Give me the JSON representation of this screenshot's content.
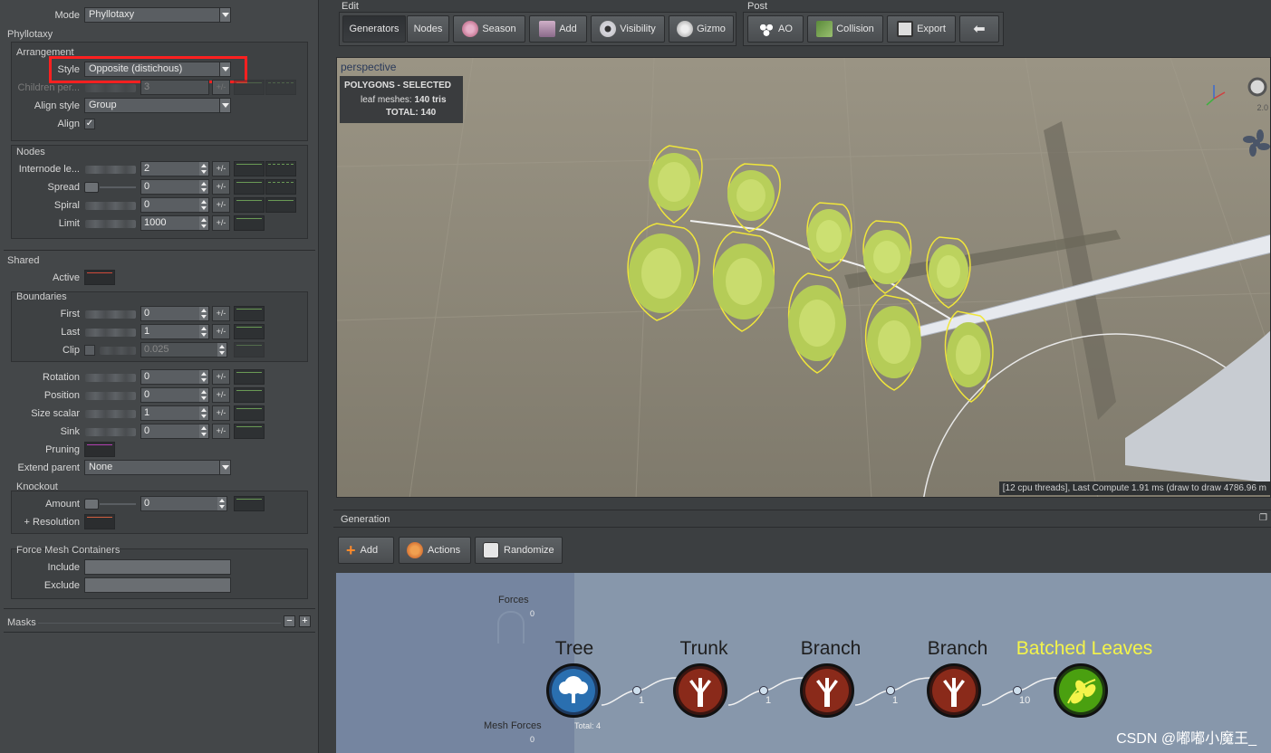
{
  "left": {
    "mode_label": "Mode",
    "mode_value": "Phyllotaxy",
    "phyllotaxy_title": "Phyllotaxy",
    "arrangement_title": "Arrangement",
    "style_label": "Style",
    "style_value": "Opposite (distichous)",
    "children_label": "Children per...",
    "children_value": "3",
    "align_style_label": "Align style",
    "align_style_value": "Group",
    "align_label": "Align",
    "align_checked": "✓",
    "nodes_title": "Nodes",
    "internode_label": "Internode le...",
    "internode_value": "2",
    "spread_label": "Spread",
    "spread_value": "0",
    "spiral_label": "Spiral",
    "spiral_value": "0",
    "limit_label": "Limit",
    "limit_value": "1000",
    "shared_title": "Shared",
    "active_label": "Active",
    "boundaries_title": "Boundaries",
    "first_label": "First",
    "first_value": "0",
    "last_label": "Last",
    "last_value": "1",
    "clip_label": "Clip",
    "clip_value": "0.025",
    "rotation_label": "Rotation",
    "rotation_value": "0",
    "position_label": "Position",
    "position_value": "0",
    "size_label": "Size scalar",
    "size_value": "1",
    "sink_label": "Sink",
    "sink_value": "0",
    "pruning_label": "Pruning",
    "extend_label": "Extend parent",
    "extend_value": "None",
    "knockout_title": "Knockout",
    "amount_label": "Amount",
    "amount_value": "0",
    "resolution_label": "+ Resolution",
    "fmc_title": "Force Mesh Containers",
    "include_label": "Include",
    "exclude_label": "Exclude",
    "masks_label": "Masks",
    "pm_label": "+/-",
    "colors": {
      "active_line": "#d04a3a",
      "pruning_line": "#b040b0",
      "resolution_line": "#d06040",
      "highlight_box": "#ff2020"
    }
  },
  "toolbar": {
    "edit_title": "Edit",
    "generators": "Generators",
    "nodes": "Nodes",
    "season": "Season",
    "add": "Add",
    "visibility": "Visibility",
    "gizmo": "Gizmo",
    "post_title": "Post",
    "ao": "AO",
    "collision": "Collision",
    "export": "Export"
  },
  "viewport": {
    "title": "perspective",
    "poly_title": "POLYGONS - SELECTED",
    "leaf_label": "leaf meshes:",
    "leaf_value": "140 tris",
    "total_label": "TOTAL:",
    "total_value": "140",
    "scale_label": "2.0",
    "status": "[12 cpu threads], Last Compute 1.91 ms (draw to draw 4786.96 m"
  },
  "generation": {
    "title": "Generation",
    "add": "Add",
    "actions": "Actions",
    "randomize": "Randomize",
    "forces_label": "Forces",
    "forces_count": "0",
    "mesh_forces_label": "Mesh Forces",
    "mesh_forces_count": "0",
    "total_label": "Total: 4",
    "nodes": [
      {
        "label": "Tree",
        "count": ""
      },
      {
        "label": "Trunk",
        "count": "1"
      },
      {
        "label": "Branch",
        "count": "1"
      },
      {
        "label": "Branch",
        "count": "1"
      },
      {
        "label": "Batched Leaves",
        "count": "10"
      }
    ]
  },
  "watermark": "CSDN @嘟嘟小魔王_"
}
